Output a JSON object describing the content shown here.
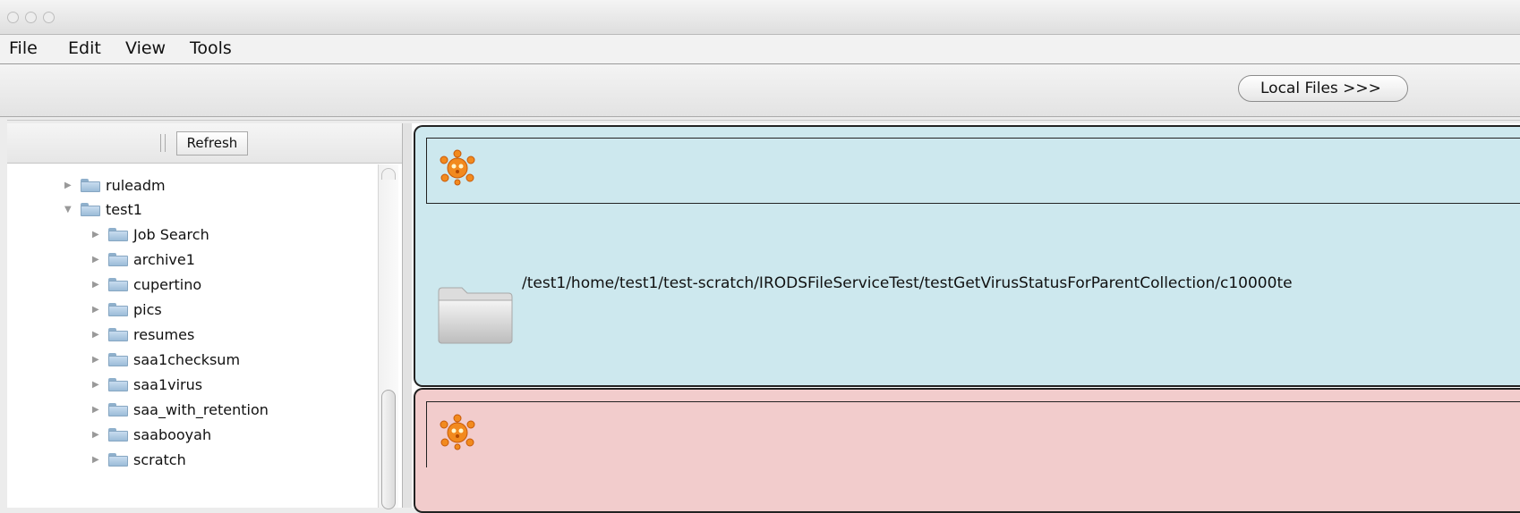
{
  "menubar": {
    "items": [
      "File",
      "Edit",
      "View",
      "Tools"
    ]
  },
  "toolbar": {
    "local_files_label": "Local Files >>>"
  },
  "tree_toolbar": {
    "refresh_label": "Refresh"
  },
  "tree": {
    "items": [
      {
        "label": "ruleadm",
        "expanded": false
      },
      {
        "label": "test1",
        "expanded": true
      },
      {
        "label": "Job Search",
        "expanded": false
      },
      {
        "label": "archive1",
        "expanded": false
      },
      {
        "label": "cupertino",
        "expanded": false
      },
      {
        "label": "pics",
        "expanded": false
      },
      {
        "label": "resumes",
        "expanded": false
      },
      {
        "label": "saa1checksum",
        "expanded": false
      },
      {
        "label": "saa1virus",
        "expanded": false
      },
      {
        "label": "saa_with_retention",
        "expanded": false
      },
      {
        "label": "saabooyah",
        "expanded": false
      },
      {
        "label": "scratch",
        "expanded": false
      }
    ]
  },
  "results": {
    "items": [
      {
        "status": "virus",
        "color": "#cde8ee",
        "path": "/test1/home/test1/test-scratch/IRODSFileServiceTest/testGetVirusStatusForParentCollection/c10000te"
      },
      {
        "status": "virus",
        "color": "#f2cccc"
      }
    ]
  }
}
